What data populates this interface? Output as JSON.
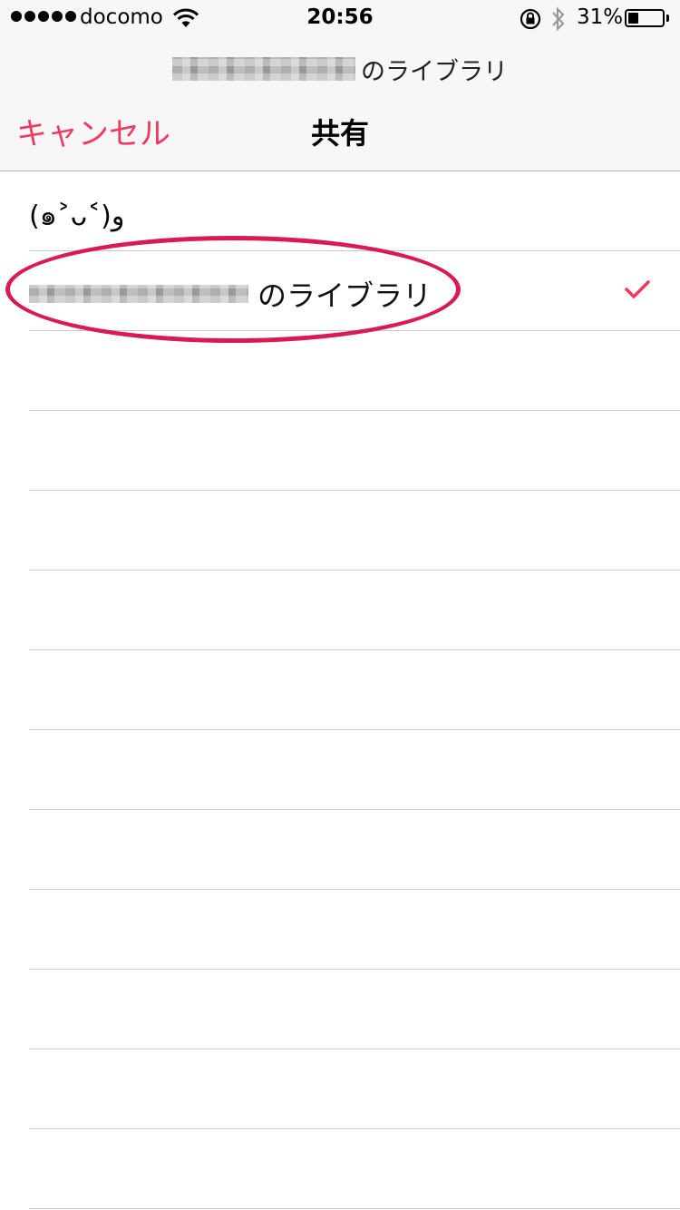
{
  "status_bar": {
    "carrier": "docomo",
    "time": "20:56",
    "battery_percent": "31%",
    "battery_level": 0.31,
    "icons": [
      "signal-dots-icon",
      "wifi-icon",
      "rotation-lock-icon",
      "bluetooth-icon",
      "battery-icon"
    ]
  },
  "header": {
    "subtitle_suffix": "のライブラリ",
    "cancel_label": "キャンセル",
    "title": "共有"
  },
  "list": {
    "items": [
      {
        "label": "(๑˃ᴗ˂)و",
        "selected": false
      },
      {
        "label_suffix": "のライブラリ",
        "selected": true,
        "redacted_prefix": true
      },
      {
        "label": ""
      },
      {
        "label": ""
      },
      {
        "label": ""
      },
      {
        "label": ""
      },
      {
        "label": ""
      },
      {
        "label": ""
      },
      {
        "label": ""
      },
      {
        "label": ""
      },
      {
        "label": ""
      },
      {
        "label": ""
      },
      {
        "label": ""
      }
    ]
  },
  "colors": {
    "accent": "#ef3a5d",
    "annotation": "#d81b52",
    "header_bg": "#f7f7f7",
    "separator": "#c8c7cc"
  }
}
